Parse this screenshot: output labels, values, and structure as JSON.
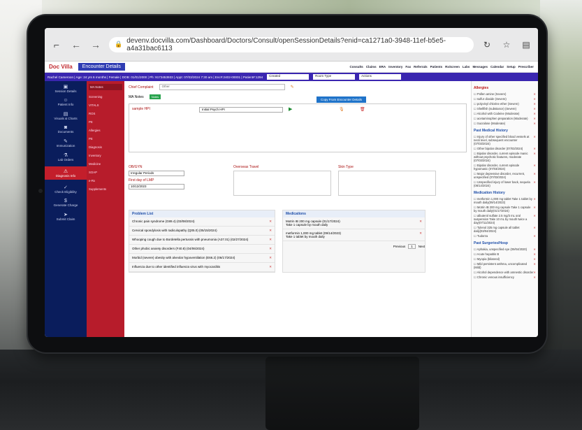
{
  "browser": {
    "url": "devenv.docvilla.com/Dashboard/Doctors/Consult/openSessionDetails?enid=ca1271a0-3948-11ef-b5e5-a4a31bac6113"
  },
  "app": {
    "logo_main": "Doc Villa",
    "encounter_title": "Encounter Details",
    "topnav": [
      "Consults",
      "Claims",
      "ERA",
      "Inventory",
      "Fax",
      "Referrals",
      "Patients",
      "RxScreen",
      "Labs",
      "Messages",
      "Calendar",
      "Setup",
      "Prescriber"
    ],
    "patient_info": "Rachel Cameroon | Age: 24 yrs 6 months | Female | DOB: 01/01/2000 | Ph: 9173453933 | Appt: 07/03/2024 7:30 am | Enc#:2402-00001 | Patient#:1294",
    "status_select": "Created",
    "room_select": "Room Type",
    "actions_select": "Actions"
  },
  "leftnav": [
    {
      "label": "Session Details",
      "icon": "clipboard-icon"
    },
    {
      "label": "Patient Info",
      "icon": "user-icon"
    },
    {
      "label": "Visuals & Charts",
      "icon": "chart-icon"
    },
    {
      "label": "Documents",
      "icon": "document-icon"
    },
    {
      "label": "Immunization",
      "icon": "syringe-icon"
    },
    {
      "label": "Lab Orders",
      "icon": "flask-icon"
    },
    {
      "label": "Diagnosis Info",
      "icon": "warning-icon",
      "active": true
    },
    {
      "label": "Check Eligibility",
      "icon": "check-icon"
    },
    {
      "label": "Generate Charge",
      "icon": "dollar-icon"
    },
    {
      "label": "Submit Claim",
      "icon": "send-icon"
    }
  ],
  "subnav": [
    {
      "label": "MA Notes",
      "active": true
    },
    {
      "label": "Screening"
    },
    {
      "label": "VITALS"
    },
    {
      "label": "ROS"
    },
    {
      "label": "PE"
    },
    {
      "label": "Allergies"
    },
    {
      "label": "PE"
    },
    {
      "label": "Diagnosis"
    },
    {
      "label": "Inventory"
    },
    {
      "label": "Medicine"
    },
    {
      "label": "SOAP"
    },
    {
      "label": "e-Rx"
    },
    {
      "label": "Supplements"
    }
  ],
  "main": {
    "cc_label": "Chief Complaint",
    "cc_value": "Other",
    "ma_notes": "MA Notes",
    "copy_btn": "Copy From Encounter Details",
    "hpi_label": "sample HPI",
    "hpi_select": "Initial Psych HPI",
    "obgyn_label": "OB/GYN",
    "obgyn_select": "Irregular Periods",
    "lmp_label": "First day of LMP",
    "lmp_value": "10/12/2023",
    "overseas_label": "Overseas Travel",
    "skin_label": "Skin Type"
  },
  "problems": {
    "title": "Problem List",
    "items": [
      "Chronic pain syndrome (G89.4) (03/08/2024)",
      "Cervical spondylosis with radiculopathy (Q05.0) (05/15/2024)",
      "Whooping cough due to Bordetella pertussis with pneumonia (A37.01) (02/27/2024)",
      "Other phobic anxiety disorders (F40.8) (04/06/2024)",
      "Morbid (severe) obesity with alveolar hypoventilation (E66.2) (06/17/2024)",
      "Influenza due to other identified influenza virus with myocarditis"
    ]
  },
  "medications": {
    "title": "Medications",
    "items": [
      {
        "name": "Motrin IB 200 mg capsule (01/17/2024)",
        "sig": "Take 1 capsule by mouth daily"
      },
      {
        "name": "metformin 1,000 mg tablet (09/14/2023)",
        "sig": "Take 1 tablet by mouth daily"
      }
    ],
    "previous": "Previous",
    "page": "1",
    "next": "Next"
  },
  "right": {
    "allergies_title": "Allergies",
    "allergies": [
      "Pollen amine (Severe)",
      "sulfur dioxide (Severe)",
      "polyvinyl chlorine ether (Severe)",
      "Shellfish (substance) (Severe)",
      "Alcohol with Codeine (Moderate)",
      "acetaminophen preparation (Moderate)",
      "Sucralose (Moderate)"
    ],
    "pmh_title": "Past Medical History",
    "pmh": [
      "Injury of other specified blood vessels at neck level, subsequent encounter (07/03/2024)",
      "Other bipolar disorder (07/03/2024)",
      "Bipolar disorder, current episode manic without psychotic features, moderate (07/03/2024)",
      "Bipolar disorder, current episode hypomanic (07/03/2024)",
      "Major depressive disorder, recurrent, unspecified (07/03/2024)",
      "Unspecified injury of lower back, sequela (06/14/2024)"
    ],
    "medhist_title": "Medication History",
    "medhist": [
      "metformin 1,000 mg tablet Take 1 tablet by mouth daily(09/14/2023)",
      "Motrin IB 200 mg capsule Take 1 capsule by mouth daily(01/17/2024)",
      "albuterol sulfate 2.5 mg/3 mL oral suspension Take 10 mL by mouth twice a day(07/11/2024)",
      "Tylenol 325 mg capsule all tablet daily(03/04/2024)",
      "Tudorza"
    ],
    "surg_title": "Past Surgeries/Hosp",
    "surg": [
      "Aphakia, unspecified eye (09/04/2020)",
      "Acute hepatitis B",
      "Myopia (bilateral)",
      "Mild persistent asthma, uncomplicated (Mild)",
      "Alcohol dependence with amnestic disorder",
      "Chronic venous insufficiency"
    ]
  }
}
